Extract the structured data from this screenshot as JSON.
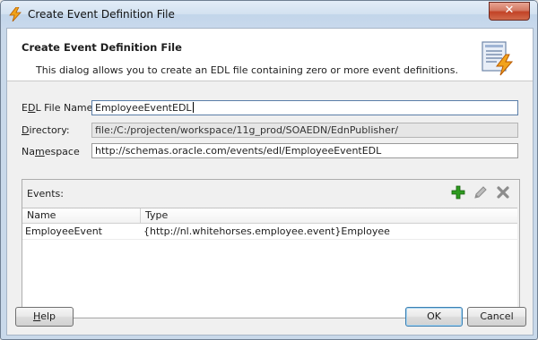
{
  "window": {
    "title": "Create Event Definition File",
    "close_glyph": "✕"
  },
  "header": {
    "title": "Create Event Definition File",
    "description": "This dialog allows you to create an EDL file containing zero or more event definitions."
  },
  "form": {
    "edl_file_name": {
      "label_pre": "E",
      "label_ul": "D",
      "label_post": "L File Name:",
      "value": "EmployeeEventEDL"
    },
    "directory": {
      "label_pre": "",
      "label_ul": "D",
      "label_post": "irectory:",
      "value": "file:/C:/projecten/workspace/11g_prod/SOAEDN/EdnPublisher/"
    },
    "namespace": {
      "label_pre": "Na",
      "label_ul": "m",
      "label_post": "espace",
      "value": "http://schemas.oracle.com/events/edl/EmployeeEventEDL"
    }
  },
  "events": {
    "label": "Events:",
    "tools": [
      "add-icon",
      "edit-icon",
      "delete-icon"
    ],
    "columns": [
      "Name",
      "Type"
    ],
    "rows": [
      {
        "name": "EmployeeEvent",
        "type": "{http://nl.whitehorses.employee.event}Employee"
      }
    ]
  },
  "buttons": {
    "help_ul": "H",
    "help_post": "elp",
    "ok": "OK",
    "cancel": "Cancel"
  },
  "colors": {
    "titlebar": "#c8d9ec",
    "close_button": "#c24226",
    "add_icon": "#2e9a1f"
  }
}
